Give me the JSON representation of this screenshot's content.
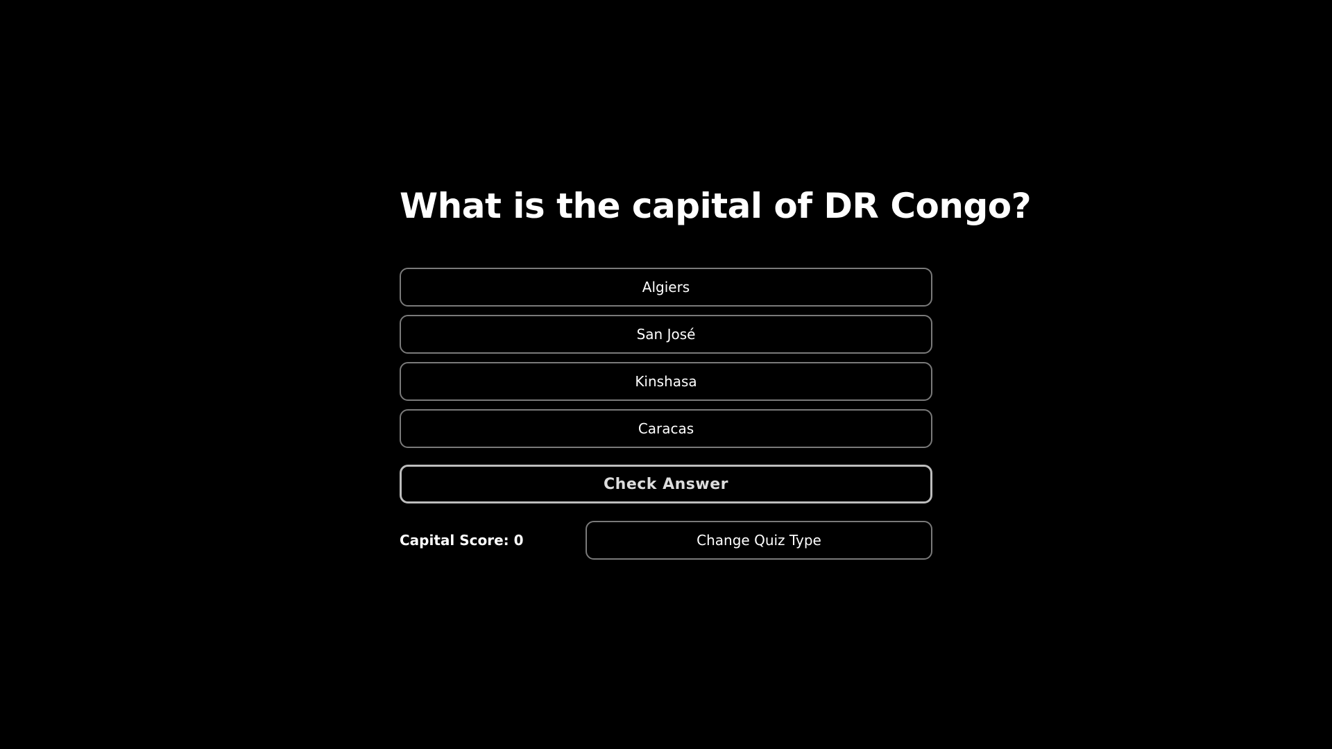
{
  "question": "What is the capital of DR Congo?",
  "options": [
    {
      "label": "Algiers"
    },
    {
      "label": "San José"
    },
    {
      "label": "Kinshasa"
    },
    {
      "label": "Caracas"
    }
  ],
  "check_answer_label": "Check Answer",
  "score_text": "Capital Score: 0",
  "change_quiz_label": "Change Quiz Type",
  "colors": {
    "background": "#000000",
    "text": "#ffffff",
    "border": "#7a7a7a",
    "check_border": "#bdbdbd"
  }
}
